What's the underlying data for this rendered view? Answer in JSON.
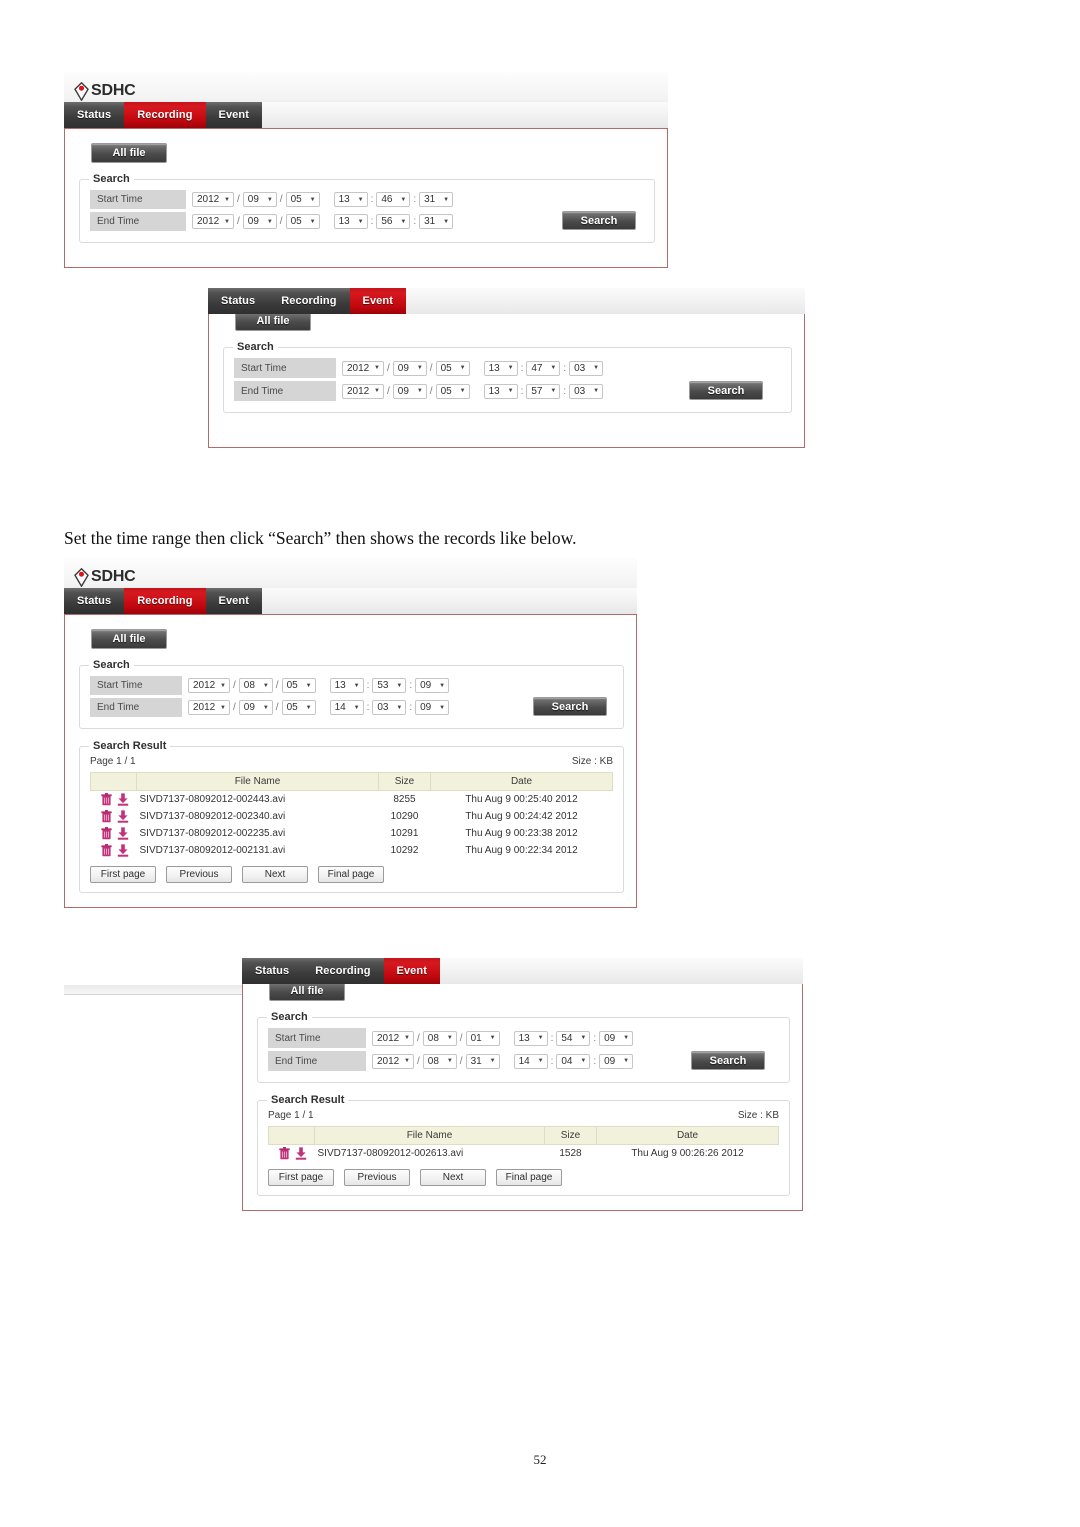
{
  "document": {
    "body_text": "Set the time range then click “Search” then shows the records like below.",
    "page_number": "52"
  },
  "common": {
    "brand": "SDHC",
    "tabs": [
      "Status",
      "Recording",
      "Event"
    ],
    "all_file_label": "All file",
    "search_button_label": "Search",
    "search_legend": "Search",
    "search_result_legend": "Search Result",
    "start_time_label": "Start Time",
    "end_time_label": "End Time",
    "size_unit_label": "Size : KB",
    "columns": [
      "",
      "File Name",
      "Size",
      "Date"
    ],
    "pager": [
      "First page",
      "Previous",
      "Next",
      "Final page"
    ],
    "caret_glyph": "▼",
    "date_separator": "/",
    "time_separator": ":",
    "icons": {
      "delete": "trash-icon",
      "download": "download-icon",
      "dropdown": "chevron-down-icon"
    },
    "colors": {
      "active_tab": "#c1080e",
      "panel_border": "#b06b6b",
      "table_header_bg": "#f2f1dc",
      "icon_pink": "#cc3a7e",
      "label_cell_bg": "#d5d5d5"
    }
  },
  "panels": [
    {
      "id": "recording-search-1",
      "active_tab": "Recording",
      "has_results": false,
      "start_time": {
        "year": "2012",
        "month": "09",
        "day": "05",
        "hour": "13",
        "minute": "46",
        "second": "31"
      },
      "end_time": {
        "year": "2012",
        "month": "09",
        "day": "05",
        "hour": "13",
        "minute": "56",
        "second": "31"
      }
    },
    {
      "id": "event-search-1",
      "active_tab": "Event",
      "has_results": false,
      "start_time": {
        "year": "2012",
        "month": "09",
        "day": "05",
        "hour": "13",
        "minute": "47",
        "second": "03"
      },
      "end_time": {
        "year": "2012",
        "month": "09",
        "day": "05",
        "hour": "13",
        "minute": "57",
        "second": "03"
      }
    },
    {
      "id": "recording-results",
      "active_tab": "Recording",
      "has_results": true,
      "start_time": {
        "year": "2012",
        "month": "08",
        "day": "05",
        "hour": "13",
        "minute": "53",
        "second": "09"
      },
      "end_time": {
        "year": "2012",
        "month": "09",
        "day": "05",
        "hour": "14",
        "minute": "03",
        "second": "09"
      },
      "page_info": "Page 1 / 1",
      "rows": [
        {
          "name": "SIVD7137-08092012-002443.avi",
          "size": "8255",
          "date": "Thu Aug 9 00:25:40 2012"
        },
        {
          "name": "SIVD7137-08092012-002340.avi",
          "size": "10290",
          "date": "Thu Aug 9 00:24:42 2012"
        },
        {
          "name": "SIVD7137-08092012-002235.avi",
          "size": "10291",
          "date": "Thu Aug 9 00:23:38 2012"
        },
        {
          "name": "SIVD7137-08092012-002131.avi",
          "size": "10292",
          "date": "Thu Aug 9 00:22:34 2012"
        }
      ]
    },
    {
      "id": "event-results",
      "active_tab": "Event",
      "has_results": true,
      "start_time": {
        "year": "2012",
        "month": "08",
        "day": "01",
        "hour": "13",
        "minute": "54",
        "second": "09"
      },
      "end_time": {
        "year": "2012",
        "month": "08",
        "day": "31",
        "hour": "14",
        "minute": "04",
        "second": "09"
      },
      "page_info": "Page 1 / 1",
      "rows": [
        {
          "name": "SIVD7137-08092012-002613.avi",
          "size": "1528",
          "date": "Thu Aug 9 00:26:26 2012"
        }
      ]
    }
  ]
}
